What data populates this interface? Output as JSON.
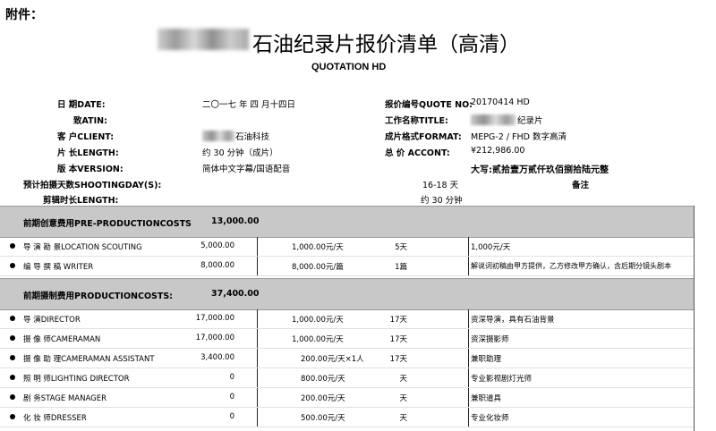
{
  "attachment_label": "附件：",
  "title": "石油纪录片报价清单（高清）",
  "subtitle": "QUOTATION HD",
  "info_left": [
    {
      "label": "日  期DATE:",
      "value": "二〇一七 年 四 月十四日"
    },
    {
      "label": "致ATIN:",
      "value": ""
    },
    {
      "label": "客  户CLIENT:",
      "value": "石油科技"
    },
    {
      "label": "片  长LENGTH:",
      "value": "约 30 分钟（成片）"
    },
    {
      "label": "版  本VERSION:",
      "value": "简体中文字幕/国语配音"
    }
  ],
  "info_right": [
    {
      "label": "报价编号QUOTE NO:",
      "value": "20170414 HD"
    },
    {
      "label": "工作名称TITLE:",
      "value": "纪录片"
    },
    {
      "label": "成片格式FORMAT:",
      "value": "MEPG-2 / FHD 数字高清"
    },
    {
      "label": "总   价 ACCONT:",
      "value": "¥212,986.00"
    }
  ],
  "total_in_words": "大写:贰拾壹万贰仟玖佰捌拾陆元整",
  "shooting_days": {
    "label": "预计拍摄天数SHOOTINGDAY(S):",
    "value": "16-18 天",
    "note": "备注"
  },
  "edit_length": {
    "label": "剪辑时长LENGTH:",
    "value": "约 30 分钟"
  },
  "sections": [
    {
      "name": "前期创意费用PRE-PRODUCTIONCOSTS",
      "total": "13,000.00",
      "rows": [
        {
          "item": "导 演 勘 景LOCATION SCOUTING",
          "amount": "5,000.00",
          "unit_price": "1,000.00元/天",
          "qty": "5天",
          "remark": "1,000元/天"
        },
        {
          "item": "编 导 撰 稿 WRITER",
          "amount": "8,000.00",
          "unit_price": "8,000.00元/篇",
          "qty": "1篇",
          "remark": "解说词初稿由甲方提供，乙方修改甲方确认，含后期分镜头剧本"
        }
      ]
    },
    {
      "name": "前期摄制费用PRODUCTIONCOSTS:",
      "total": "37,400.00",
      "rows": [
        {
          "item": "导          演DIRECTOR",
          "amount": "17,000.00",
          "unit_price": "1,000.00元/天",
          "qty": "17天",
          "remark": "资深导演，具有石油背景"
        },
        {
          "item": "摄    像    师CAMERAMAN",
          "amount": "17,000.00",
          "unit_price": "1,000.00元/天",
          "qty": "17天",
          "remark": "资深摄影师"
        },
        {
          "item": "摄 像 助 理CAMERAMAN ASSISTANT",
          "amount": "3,400.00",
          "unit_price": "200.00元/天×1人",
          "qty": "17天",
          "remark": "兼职助理"
        },
        {
          "item": "照    明    师LIGHTING DIRECTOR",
          "amount": "0",
          "unit_price": "800.00元/天",
          "qty": "天",
          "remark": "专业影视剧灯光师"
        },
        {
          "item": "剧          务STAGE MANAGER",
          "amount": "0",
          "unit_price": "200.00元/天",
          "qty": "天",
          "remark": "兼职道具"
        },
        {
          "item": "化    妆    师DRESSER",
          "amount": "0",
          "unit_price": "500.00元/天",
          "qty": "天",
          "remark": "专业化妆师"
        }
      ]
    }
  ]
}
